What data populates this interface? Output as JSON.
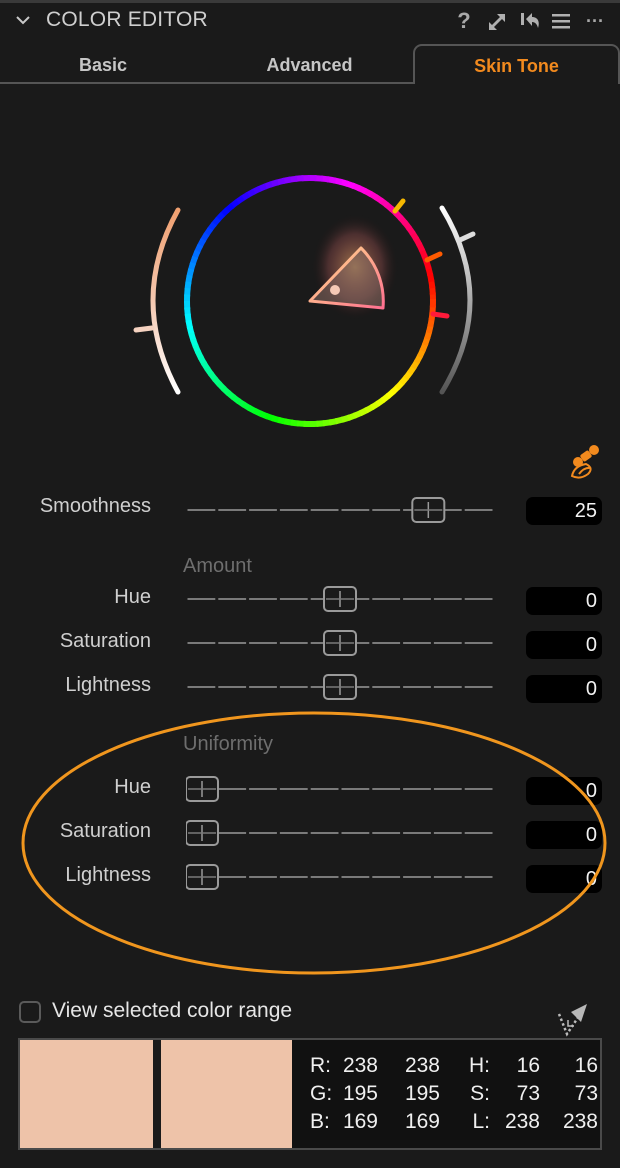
{
  "header": {
    "title": "COLOR EDITOR",
    "icons": [
      "collapse-chevron-icon",
      "help-icon",
      "expand-icon",
      "reset-icon",
      "presets-menu-icon",
      "more-options-icon"
    ],
    "help_glyph": "?",
    "more_glyph": "···"
  },
  "tabs": [
    {
      "label": "Basic",
      "active": false
    },
    {
      "label": "Advanced",
      "active": false
    },
    {
      "label": "Skin Tone",
      "active": true
    }
  ],
  "colors": {
    "accent": "#f28a1e",
    "background": "#1a1a1a",
    "selected_color": "#eec3a9"
  },
  "wheel": {
    "selected_hue_deg": 16,
    "outer_left_arc": "skin-saturation-indicator",
    "outer_right_arc": "lightness-indicator"
  },
  "smoothness": {
    "label": "Smoothness",
    "value": "25",
    "position_fraction": 0.82
  },
  "amount": {
    "title": "Amount",
    "rows": [
      {
        "label": "Hue",
        "value": "0",
        "position_fraction": 0.5
      },
      {
        "label": "Saturation",
        "value": "0",
        "position_fraction": 0.5
      },
      {
        "label": "Lightness",
        "value": "0",
        "position_fraction": 0.5
      }
    ]
  },
  "uniformity": {
    "title": "Uniformity",
    "rows": [
      {
        "label": "Hue",
        "value": "0",
        "position_fraction": 0.0
      },
      {
        "label": "Saturation",
        "value": "0",
        "position_fraction": 0.0
      },
      {
        "label": "Lightness",
        "value": "0",
        "position_fraction": 0.0
      }
    ]
  },
  "view_range": {
    "label": "View selected color range",
    "checked": false
  },
  "readout": {
    "rows": [
      {
        "k1": "R:",
        "a": "238",
        "b": "238",
        "k2": "H:",
        "c": "16",
        "d": "16"
      },
      {
        "k1": "G:",
        "a": "195",
        "b": "195",
        "k2": "S:",
        "c": "73",
        "d": "73"
      },
      {
        "k1": "B:",
        "a": "169",
        "b": "169",
        "k2": "L:",
        "c": "238",
        "d": "238"
      }
    ]
  }
}
